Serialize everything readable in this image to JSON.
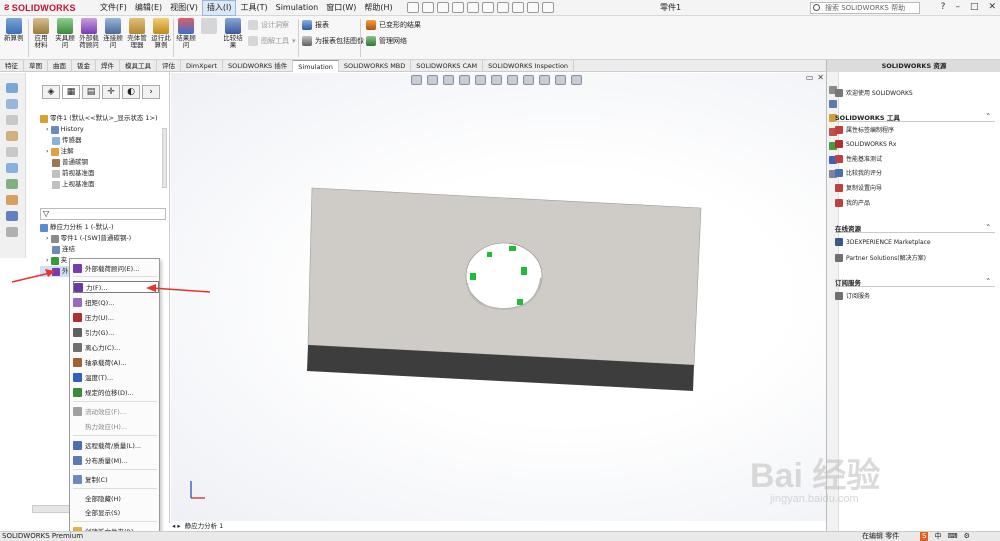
{
  "app": {
    "logo": "SOLIDWORKS",
    "doc_title": "零件1",
    "search_placeholder": "搜索 SOLIDWORKS 帮助"
  },
  "menu": [
    "文件(F)",
    "编辑(E)",
    "视图(V)",
    "插入(I)",
    "工具(T)",
    "Simulation",
    "窗口(W)",
    "帮助(H)"
  ],
  "ribbon": {
    "study": "新算例",
    "apply_material": "应用材料",
    "fixtures": "夹具顾问",
    "external_loads": "外部载荷顾问",
    "connections": "连接顾问",
    "shell_manager": "壳体管理器",
    "run": "运行此算例",
    "result_advisor": "结果顾问",
    "compare": "比较结果",
    "design_insight": "设计洞察",
    "plot_tools": "图解工具",
    "report": "报表",
    "include_image": "为报表包括图像",
    "deform_result": "已变形的结果",
    "manage_network": "管理网络"
  },
  "tabs": [
    "特征",
    "草图",
    "曲面",
    "钣金",
    "焊件",
    "模具工具",
    "评估",
    "DimXpert",
    "SOLIDWORKS 插件",
    "Simulation",
    "SOLIDWORKS MBD",
    "SOLIDWORKS CAM",
    "SOLIDWORKS Inspection"
  ],
  "tree": {
    "root": "零件1 (默认<<默认>_显示状态 1>)",
    "items": [
      "History",
      "传感器",
      "注解",
      "普通碳钢",
      "前视基准面",
      "上视基准面"
    ]
  },
  "sim_tree": {
    "study": "静应力分析 1 (-默认-)",
    "part": "零件1 (-[SW]普通碳钢-)",
    "connections": "连结",
    "fixtures": "夹",
    "ext": "外"
  },
  "context_menu": [
    "外部载荷顾问(E)...",
    "力(F)...",
    "扭矩(Q)...",
    "压力(U)...",
    "引力(G)...",
    "离心力(C)...",
    "轴承载荷(A)...",
    "温度(T)...",
    "规定的位移(D)...",
    "流动效应(F)...",
    "热力效应(H)...",
    "远程载荷/质量(L)...",
    "分布质量(M)...",
    "复制(C)",
    "全部隐藏(H)",
    "全部显示(S)",
    "创建新文件夹(R)"
  ],
  "bottom_tab": "静应力分析 1",
  "status": {
    "left": "SOLIDWORKS Premium",
    "right": "在编辑 零件"
  },
  "task_pane": {
    "title": "SOLIDWORKS 资源",
    "welcome": "欢迎使用 SOLIDWORKS",
    "tools_title": "SOLIDWORKS 工具",
    "tools": [
      "属性标签编制程序",
      "SOLIDWORKS Rx",
      "性能基准测试",
      "比较我的评分",
      "复制设置向导",
      "我的产品"
    ],
    "online_title": "在线资源",
    "online": [
      "3DEXPERIENCE Marketplace",
      "Partner Solutions(解决方案)"
    ],
    "sub_title": "订阅服务",
    "sub": [
      "订阅服务"
    ]
  },
  "watermark": {
    "main": "Bai 经验",
    "sub": "jingyan.baidu.com"
  },
  "colors": {
    "brand": "#c8102e",
    "highlight_menu": "#dde8f5",
    "part_face": "#cfccc8",
    "part_side": "#3d3d3d",
    "arrow": "#e8342c"
  }
}
